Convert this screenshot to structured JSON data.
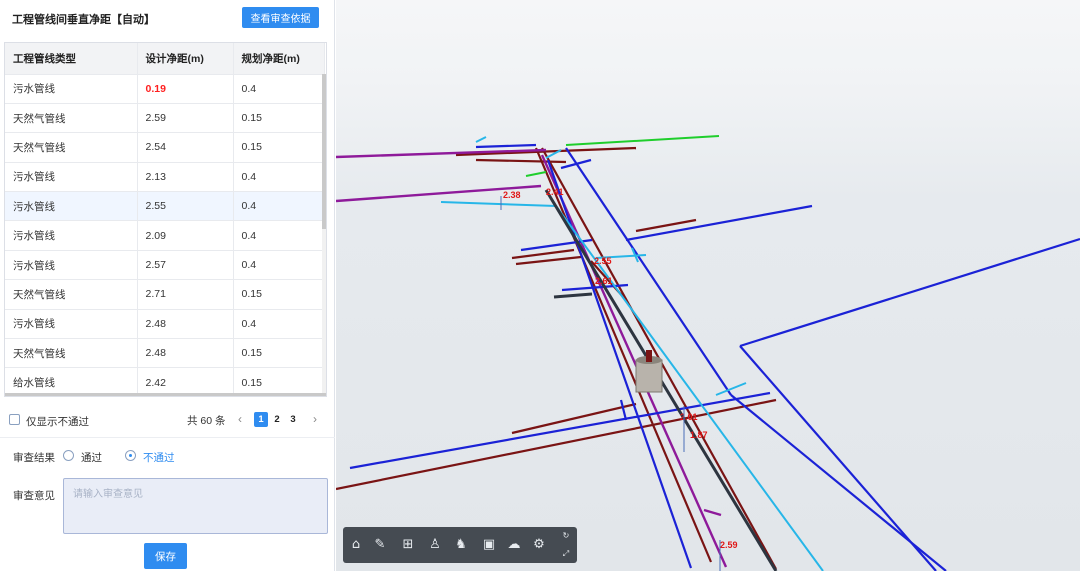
{
  "panel": {
    "title": "工程管线间垂直净距【自动】",
    "basis_button": "查看审查依据"
  },
  "table": {
    "headers": [
      "工程管线类型",
      "设计净距(m)",
      "规划净距(m)"
    ],
    "rows": [
      {
        "type": "污水管线",
        "design": "0.19",
        "plan": "0.4",
        "fail": true
      },
      {
        "type": "天然气管线",
        "design": "2.59",
        "plan": "0.15"
      },
      {
        "type": "天然气管线",
        "design": "2.54",
        "plan": "0.15"
      },
      {
        "type": "污水管线",
        "design": "2.13",
        "plan": "0.4"
      },
      {
        "type": "污水管线",
        "design": "2.55",
        "plan": "0.4"
      },
      {
        "type": "污水管线",
        "design": "2.09",
        "plan": "0.4"
      },
      {
        "type": "污水管线",
        "design": "2.57",
        "plan": "0.4"
      },
      {
        "type": "天然气管线",
        "design": "2.71",
        "plan": "0.15"
      },
      {
        "type": "污水管线",
        "design": "2.48",
        "plan": "0.4"
      },
      {
        "type": "天然气管线",
        "design": "2.48",
        "plan": "0.15"
      },
      {
        "type": "给水管线",
        "design": "2.42",
        "plan": "0.15"
      }
    ]
  },
  "filter": {
    "only_failed_label": "仅显示不通过",
    "only_failed_checked": false
  },
  "pagination": {
    "total_label": "共 60 条",
    "pages": [
      "1",
      "2",
      "3"
    ],
    "current": "1"
  },
  "review": {
    "result_label": "审查结果",
    "options": [
      "通过",
      "不通过"
    ],
    "selected": "不通过",
    "opinion_label": "审查意见",
    "opinion_placeholder": "请输入审查意见",
    "opinion_value": "",
    "save_label": "保存"
  },
  "viewport": {
    "dimension_labels": [
      "2.38",
      "2.41",
      "2.55",
      "2.61",
      "2.01",
      "1.87",
      "2.59"
    ],
    "toolbar_icons": [
      "home-icon",
      "measure-icon",
      "section-icon",
      "person-icon",
      "walk-icon",
      "layer-icon",
      "weather-icon",
      "settings-icon",
      "refresh-icon",
      "fullscreen-icon"
    ]
  },
  "colors": {
    "accent": "#2f8cf0",
    "fail": "#ff2020",
    "pipe_sewage": "#7a1414",
    "pipe_gas": "#8e1a9a",
    "pipe_water": "#1b22d6",
    "pipe_reclaimed": "#27b6e8",
    "pipe_power": "#1fce2c"
  }
}
